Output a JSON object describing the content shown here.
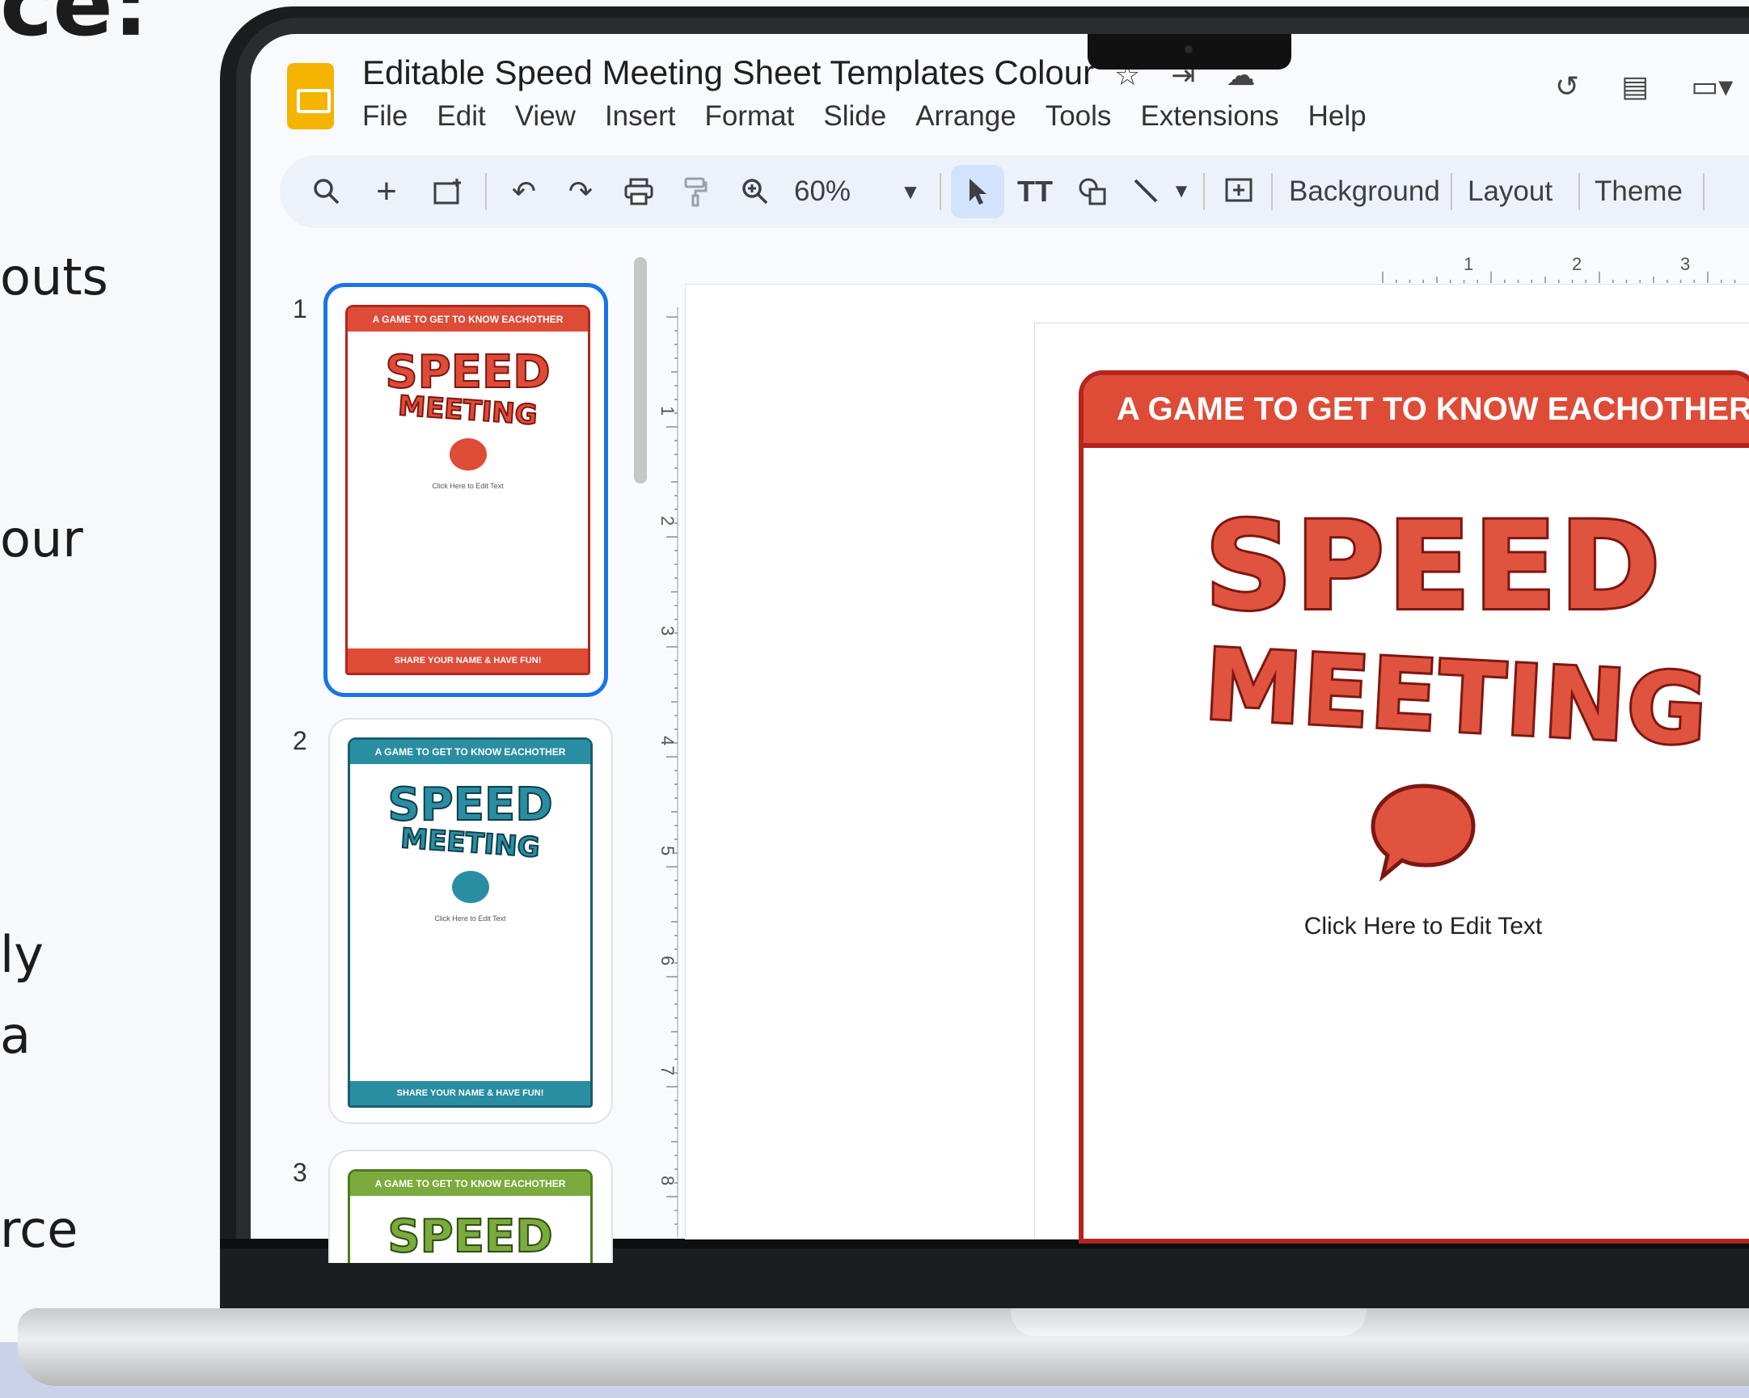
{
  "left_text": {
    "heading_fragment": "ce:",
    "line1": "outs",
    "line2": "our",
    "line3": "ly",
    "line4": "a",
    "line5": "rce"
  },
  "app": {
    "doc_title": "Editable Speed Meeting Sheet Templates Colour",
    "menu": [
      "File",
      "Edit",
      "View",
      "Insert",
      "Format",
      "Slide",
      "Arrange",
      "Tools",
      "Extensions",
      "Help"
    ],
    "title_icons": [
      "star-icon",
      "move-to-folder-icon",
      "cloud-saved-icon"
    ],
    "header_right_icons": [
      "version-history-icon",
      "comments-icon",
      "meet-icon"
    ]
  },
  "toolbar": {
    "zoom": "60%",
    "background_label": "Background",
    "layout_label": "Layout",
    "theme_label": "Theme",
    "text_tool_label": "TT"
  },
  "ruler": {
    "horizontal_ticks": [
      "1",
      "2",
      "3"
    ],
    "vertical_ticks": [
      "1",
      "2",
      "3",
      "4",
      "5",
      "6",
      "7",
      "8"
    ]
  },
  "filmstrip": {
    "slides": [
      {
        "number": "1",
        "header": "A GAME TO GET TO KNOW EACHOTHER",
        "title1": "SPEED",
        "title2": "MEETING",
        "click": "Click Here to Edit Text",
        "footer": "SHARE YOUR NAME & HAVE FUN!",
        "color": "#de4b37",
        "dark": "#b5251d"
      },
      {
        "number": "2",
        "header": "A GAME TO GET TO KNOW EACHOTHER",
        "title1": "SPEED",
        "title2": "MEETING",
        "click": "Click Here to Edit Text",
        "footer": "SHARE YOUR NAME & HAVE FUN!",
        "color": "#2a8ea3",
        "dark": "#17606f"
      },
      {
        "number": "3",
        "header": "A GAME TO GET TO KNOW EACHOTHER",
        "title1": "SPEED",
        "title2": "",
        "click": "",
        "footer": "",
        "color": "#7aab3c",
        "dark": "#4d7a1f"
      }
    ]
  },
  "main_slide": {
    "header": "A GAME TO GET TO KNOW EACHOTHER",
    "title1": "SPEED",
    "title2": "MEETING",
    "click": "Click Here to Edit Text"
  },
  "colors": {
    "accent_red": "#de4b37",
    "selection_blue": "#1a73e8",
    "slides_yellow": "#f4b400"
  }
}
